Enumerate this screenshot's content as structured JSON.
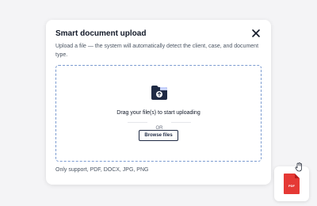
{
  "modal": {
    "title": "Smart document upload",
    "description": "Upload a file — the system will automatically detect the client, case, and document type.",
    "close_icon": "close-icon"
  },
  "dropzone": {
    "icon": "folder-upload-icon",
    "drag_text": "Drag your file(s) to start uploading",
    "or_text": "OR",
    "browse_label": "Browse files"
  },
  "support_text": "Only support, PDF, DOCX, JPG, PNG",
  "dragged_file": {
    "icon": "pdf-file-icon",
    "label": "PDF",
    "cursor_icon": "grab-cursor-icon"
  },
  "colors": {
    "dropzone_border": "#7b9bd0",
    "folder_icon": "#1f2a44",
    "pdf_file": "#e53935"
  }
}
